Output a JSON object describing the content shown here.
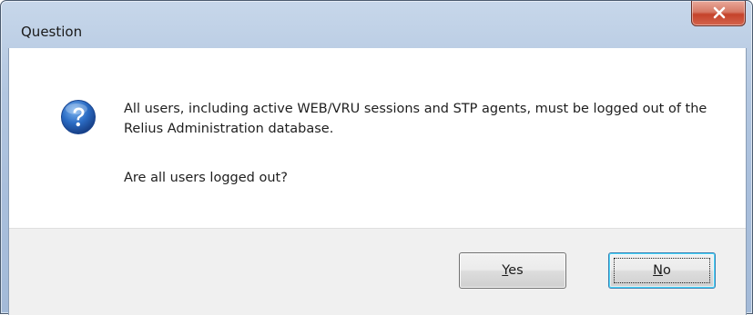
{
  "window": {
    "title": "Question"
  },
  "dialog": {
    "icon": "question-icon",
    "message": "All users, including active WEB/VRU sessions and STP agents, must be logged out of the Relius Administration database.",
    "question": "Are all users logged out?"
  },
  "buttons": {
    "yes_label": "Yes",
    "yes_mnemonic": "Y",
    "yes_rest": "es",
    "no_label": "No",
    "no_mnemonic": "N",
    "no_rest": "o"
  },
  "colors": {
    "icon_blue": "#2b6cc4",
    "close_red": "#c5432b",
    "title_frame": "#b2c6e0"
  }
}
